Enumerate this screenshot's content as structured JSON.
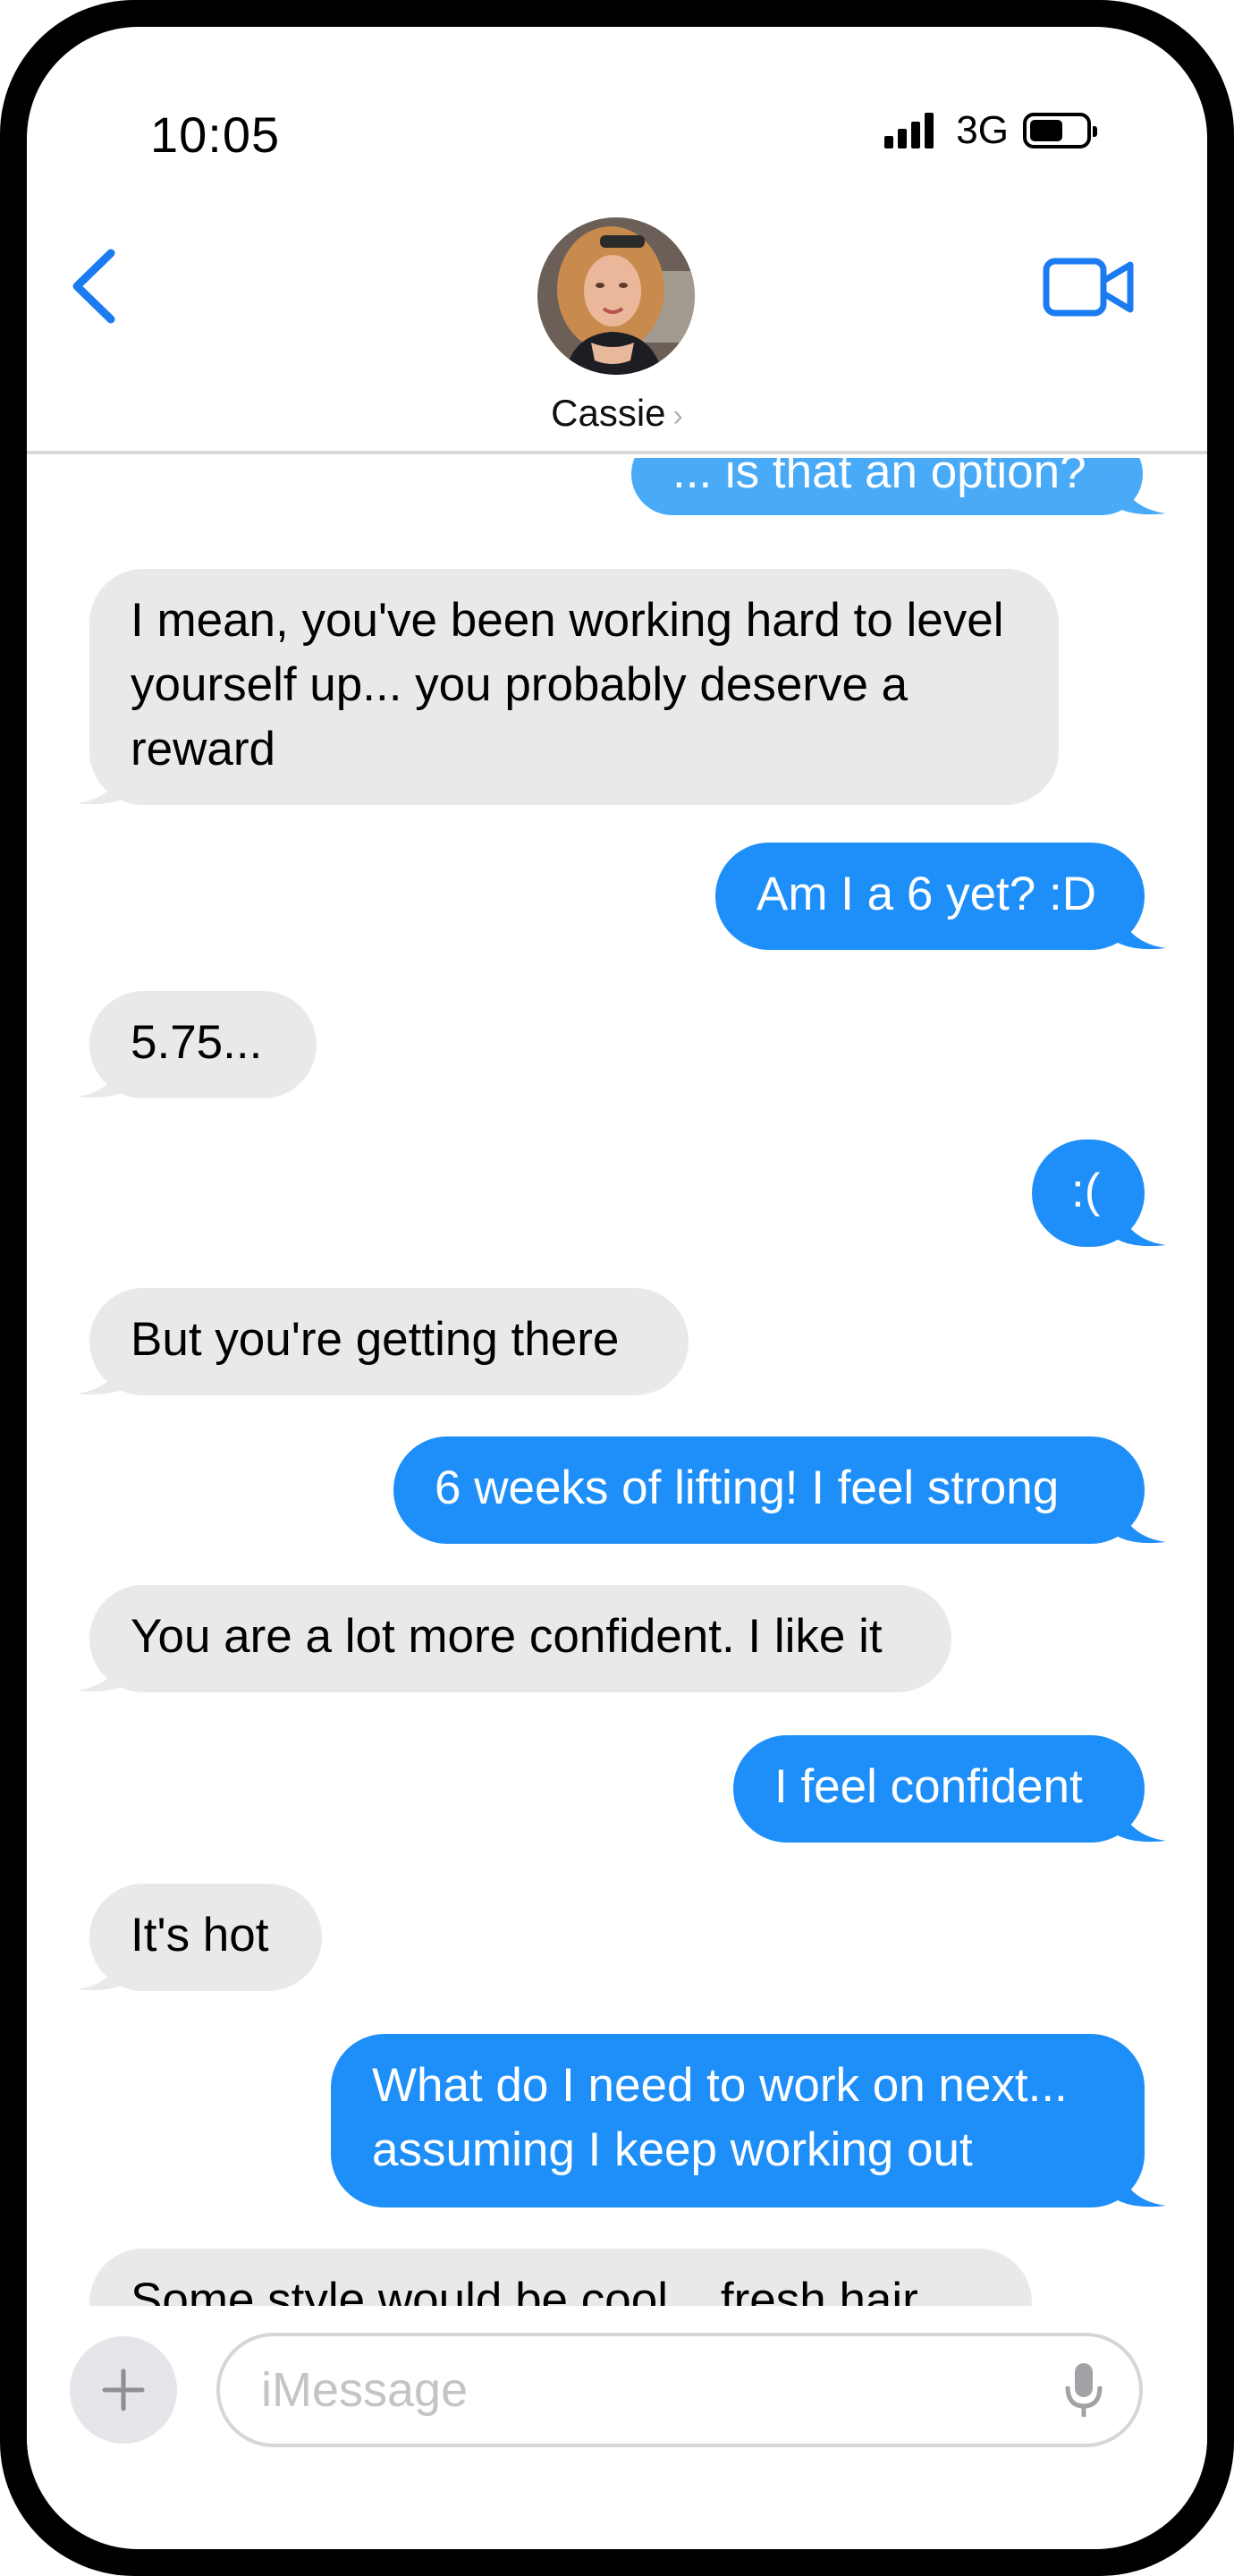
{
  "status_bar": {
    "time": "10:05",
    "network": "3G"
  },
  "header": {
    "contact_name": "Cassie",
    "chevron": "›"
  },
  "messages": [
    {
      "side": "out",
      "text": "... is that an option?"
    },
    {
      "side": "in",
      "text": "I mean, you've been working hard to level yourself up... you probably deserve a reward"
    },
    {
      "side": "out",
      "text": "Am I a 6 yet? :D"
    },
    {
      "side": "in",
      "text": "5.75..."
    },
    {
      "side": "out",
      "text": ":("
    },
    {
      "side": "in",
      "text": "But you're getting there"
    },
    {
      "side": "out",
      "text": "6 weeks of lifting!  I feel strong"
    },
    {
      "side": "in",
      "text": "You are a lot more confident.  I like it"
    },
    {
      "side": "out",
      "text": "I feel confident"
    },
    {
      "side": "in",
      "text": "It's hot"
    },
    {
      "side": "out",
      "text": "What do I need to work on next... assuming I keep working out"
    },
    {
      "side": "in",
      "text": "Some style would be cool... fresh hair"
    }
  ],
  "input": {
    "placeholder": "iMessage"
  },
  "colors": {
    "outgoing": "#1e8ff8",
    "incoming": "#e9e9eb",
    "accent": "#1a7cf0"
  },
  "icons": [
    "back-chevron-icon",
    "video-call-icon",
    "plus-icon",
    "microphone-icon",
    "signal-icon",
    "battery-icon"
  ]
}
